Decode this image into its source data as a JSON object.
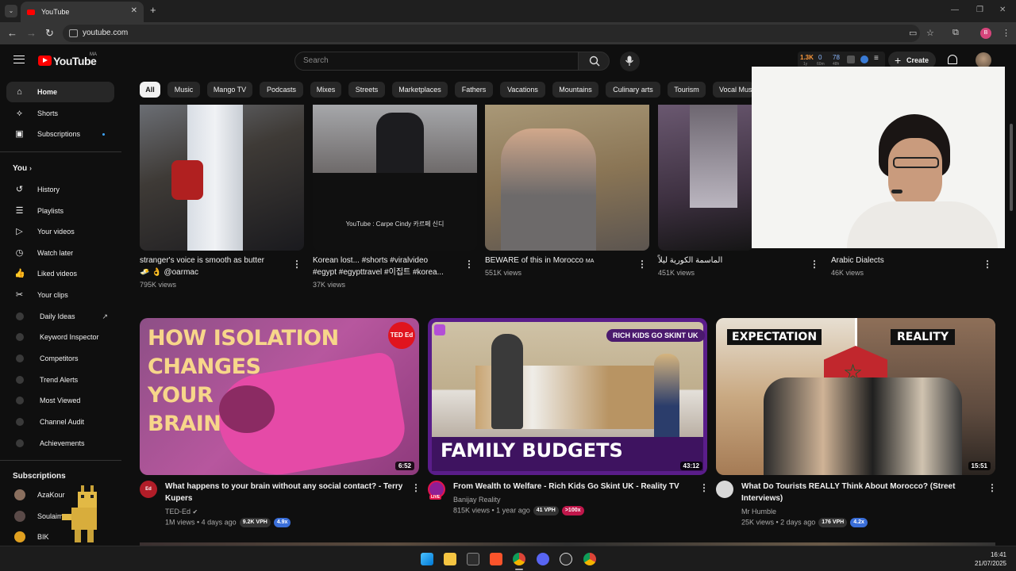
{
  "browser": {
    "tab_title": "YouTube",
    "address": "youtube.com"
  },
  "header": {
    "logo_text": "YouTube",
    "logo_region": "MA",
    "search_placeholder": "Search",
    "stats": {
      "v1": "1.3K",
      "v2": "0",
      "v3": "78",
      "s1": "1y",
      "s2": "60m",
      "s3": "48h"
    },
    "create_label": "Create"
  },
  "sidebar": {
    "main": [
      {
        "label": "Home",
        "icon": "home-icon"
      },
      {
        "label": "Shorts",
        "icon": "shorts-icon"
      },
      {
        "label": "Subscriptions",
        "icon": "subscriptions-icon"
      }
    ],
    "you_heading": "You",
    "you": [
      {
        "label": "History",
        "icon": "history-icon"
      },
      {
        "label": "Playlists",
        "icon": "playlists-icon"
      },
      {
        "label": "Your videos",
        "icon": "your-videos-icon"
      },
      {
        "label": "Watch later",
        "icon": "watch-later-icon"
      },
      {
        "label": "Liked videos",
        "icon": "liked-icon"
      },
      {
        "label": "Your clips",
        "icon": "clips-icon"
      }
    ],
    "tools": [
      "Daily Ideas",
      "Keyword Inspector",
      "Competitors",
      "Trend Alerts",
      "Most Viewed",
      "Channel Audit",
      "Achievements"
    ],
    "subscriptions_heading": "Subscriptions",
    "subscriptions": [
      "AzaKour",
      "Soulaima",
      "BIK"
    ]
  },
  "chips": [
    "All",
    "Music",
    "Mango TV",
    "Podcasts",
    "Mixes",
    "Streets",
    "Marketplaces",
    "Fathers",
    "Vacations",
    "Mountains",
    "Culinary arts",
    "Tourism",
    "Vocal Mus"
  ],
  "row1": [
    {
      "title_l1": "stranger's voice is smooth as butter",
      "title_l2": "🧈 👌 @oarmac",
      "meta": "795K views"
    },
    {
      "title_l1": "Korean lost... #shorts #viralvideo",
      "title_l2": "#egypt #egypttravel #이집트 #korea...",
      "meta": "37K views",
      "overlay": "YouTube : Carpe Cindy 카르페 신디"
    },
    {
      "title_l1": "BEWARE of this in Morocco",
      "title_flag": "MA",
      "meta": "551K views"
    },
    {
      "title_l1": "الماسمة الكورية ليلاً",
      "meta": "451K views"
    },
    {
      "title_l1": "Arabic Dialects",
      "meta": "46K views"
    }
  ],
  "row2": [
    {
      "thumb_lines": [
        "HOW ISOLATION",
        "CHANGES",
        "YOUR",
        "BRAIN"
      ],
      "thumb_logo": "TED Ed",
      "duration": "6:52",
      "title_l1": "What happens to your brain without any social contact? - Terry",
      "title_l2": "Kupers",
      "channel": "TED-Ed",
      "meta": "1M views • 4 days ago",
      "badge1": "9.2K VPH",
      "badge2": "4.9x"
    },
    {
      "thumb_banner": "RICH KIDS GO SKINT UK",
      "thumb_caption": "FAMILY BUDGETS",
      "duration": "43:12",
      "title_l1": "From Wealth to Welfare - Rich Kids Go Skint UK - Reality TV",
      "channel": "Banijay Reality",
      "meta": "815K views • 1 year ago",
      "live": "LIVE",
      "badge1": "41 VPH",
      "badge2": ">100x"
    },
    {
      "thumb_left": "EXPECTATION",
      "thumb_right": "REALITY",
      "duration": "15:51",
      "title_l1": "What Do Tourists REALLY Think About Morocco? (Street",
      "title_l2": "Interviews)",
      "channel": "Mr Humble",
      "meta": "25K views • 2 days ago",
      "badge1": "176 VPH",
      "badge2": "4.2x"
    }
  ],
  "taskbar": {
    "time": "16:41",
    "date": "21/07/2025"
  },
  "colors": {
    "accent": "#ff0000",
    "chip_active": "#f1f1f1",
    "badge_blue": "#3a6ed8",
    "badge_red": "#c0174b"
  }
}
